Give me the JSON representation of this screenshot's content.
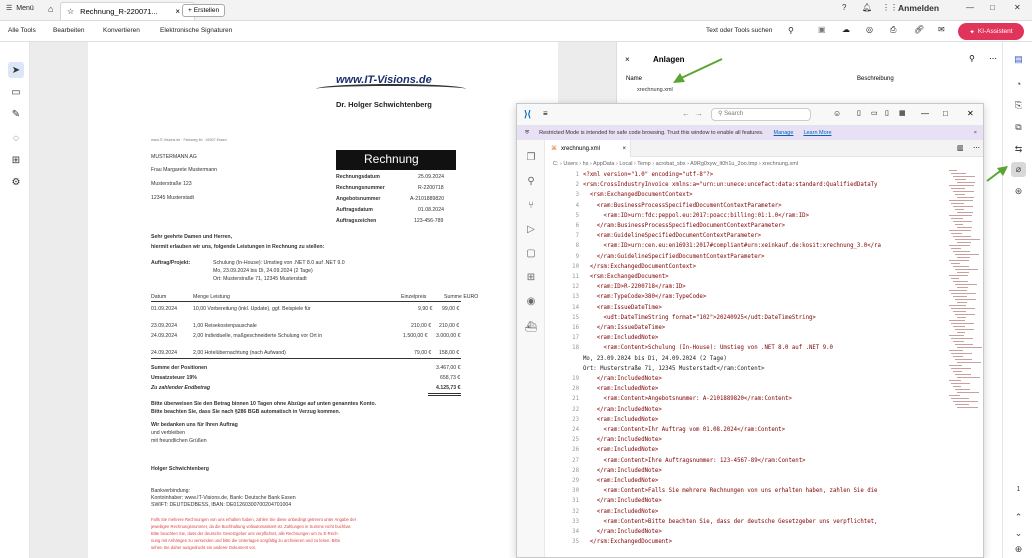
{
  "tabbar": {
    "menu_label": "Menü",
    "doc_tab_label": "Rechnung_R-220071...",
    "create_label": "Erstellen",
    "sign_in_label": "Anmelden"
  },
  "menubar": {
    "items": [
      "Alle Tools",
      "Bearbeiten",
      "Konvertieren",
      "Elektronische Signaturen"
    ],
    "search_label": "Text oder Tools suchen",
    "ai_label": "KI-Assistent"
  },
  "attachments": {
    "title": "Anlagen",
    "col_name": "Name",
    "col_desc": "Beschreibung",
    "file": "xrechnung.xml"
  },
  "invoice": {
    "logo": "www.IT-Visions.de",
    "owner": "Dr. Holger Schwichtenberg",
    "sender_line": "www.IT-Visions.de · Fahrweg 4b · 45307 Essen",
    "recipient": [
      "MUSTERMANN AG",
      "Frau Margarete Mustermann",
      "Musterstraße 123",
      "12345 Musterstadt"
    ],
    "title": "Rechnung",
    "meta": [
      {
        "label": "Rechnungsdatum",
        "value": "25.09.2024"
      },
      {
        "label": "Rechnungsnummer",
        "value": "R-2200718"
      },
      {
        "label": "Angebotsnummer",
        "value": "A-2101889820"
      },
      {
        "label": "Auftragsdatum",
        "value": "01.08.2024"
      },
      {
        "label": "Auftragszeichen",
        "value": "123-456-789"
      }
    ],
    "salutation": "Sehr geehrte Damen und Herren,",
    "intro": "hiermit erlauben wir uns, folgende Leistungen in Rechnung zu stellen:",
    "project_label": "Auftrag/Projekt:",
    "project_lines": [
      "Schulung (In-House): Umstieg von .NET 8.0 auf .NET 9.0",
      "Mo, 23.09.2024 bis Di, 24.09.2024 (2 Tage)",
      "Ort: Musterstraße 71, 12345 Musterstadt"
    ],
    "table_headers": [
      "Datum",
      "Menge Leistung",
      "Einzelpreis",
      "Summe EURO"
    ],
    "rows": [
      {
        "date": "01.09.2024",
        "desc": "10,00 Vorbereitung (inkl. Update), ggf. Beispiele für",
        "price": "9,90 €",
        "sum": "99,00 €"
      },
      {
        "date": "23.09.2024",
        "desc": "1,00 Reisekostenpauschale",
        "price": "210,00 €",
        "sum": "210,00 €"
      },
      {
        "date": "24.09.2024",
        "desc": "2,00 Individuelle, maßgeschneiderte Schulung vor Ort in",
        "price": "1.500,00 €",
        "sum": "3.000,00 €"
      },
      {
        "date": "24.09.2024",
        "desc": "2,00 Hotelübernachtung (nach Aufwand)",
        "price": "79,00 €",
        "sum": "158,00 €"
      }
    ],
    "sum_label": "Summe der Positionen",
    "sum_value": "3.467,00 €",
    "vat_label": "Umsatzsteuer 19%",
    "vat_value": "658,73 €",
    "total_label": "Zu zahlender Endbetrag",
    "total_value": "4.125,73 €",
    "payment_lines": [
      "Bitte überweisen Sie den Betrag binnen 10 Tagen ohne Abzüge auf unten genanntes Konto.",
      "Bitte beachten Sie, dass Sie nach §286 BGB automatisch in Verzug kommen."
    ],
    "thanks_lines": [
      "Wir bedanken uns für Ihren Auftrag",
      "und verbleiben",
      "mit freundlichen Grüßen"
    ],
    "signature": "Holger Schwichtenberg",
    "bank_lines": [
      "Bankverbindung:",
      "Kontoinhaber: www.IT-Visions.de, Bank: Deutsche Bank Essen",
      "SWIFT: DEUTDEDBESS, IBAN: DE01260300700204701004"
    ],
    "red_lines": [
      "Falls Sie mehrere Rechnungen von uns erhalten haben, zahlen Sie diese unbedingt getrennt unter Angabe der",
      "jeweiligen Rechnungsnummer, da die Buchhaltung vollautomatisiert ist. Zahlungen in Summe nicht buchbar.",
      "Bitte beachten Sie, dass der deutsche Gesetzgeber uns verpflichtet, alle Rechnungen um zu E-Rech-",
      "nung mit Anhängen zu versenden und bitte die Unterlagen sorgfältig zu archivieren und zu lesen. Bitte",
      "sehen Sie daher ausgedruckt ein anderer Dokument vor."
    ]
  },
  "vscode": {
    "search_placeholder": "Search",
    "banner_text": "Restricted Mode is intended for safe code browsing. Trust this window to enable all features.",
    "banner_manage": "Manage",
    "banner_learn": "Learn More",
    "tab_label": "xrechnung.xml",
    "breadcrumb": "C: › Users › hs › AppData › Local › Temp › acrobat_sbx › A9Rg0xyw_lt0h1u_2oo.tmp › xrechnung.xml",
    "lines": [
      {
        "n": "1",
        "t": "<?xml version=\"1.0\" encoding=\"utf-8\"?>"
      },
      {
        "n": "2",
        "t": "<rsm:CrossIndustryInvoice xmlns:a=\"urn:un:unece:uncefact:data:standard:QualifiedDataTy"
      },
      {
        "n": "3",
        "t": "  <rsm:ExchangedDocumentContext>"
      },
      {
        "n": "4",
        "t": "    <ram:BusinessProcessSpecifiedDocumentContextParameter>"
      },
      {
        "n": "5",
        "t": "      <ram:ID>urn:fdc:peppol.eu:2017:poacc:billing:01:1.0</ram:ID>"
      },
      {
        "n": "6",
        "t": "    </ram:BusinessProcessSpecifiedDocumentContextParameter>"
      },
      {
        "n": "7",
        "t": "    <ram:GuidelineSpecifiedDocumentContextParameter>"
      },
      {
        "n": "8",
        "t": "      <ram:ID>urn:cen.eu:en16931:2017#compliant#urn:xeinkauf.de:kosit:xrechnung_3.0</ra"
      },
      {
        "n": "9",
        "t": "    </ram:GuidelineSpecifiedDocumentContextParameter>"
      },
      {
        "n": "10",
        "t": "  </rsm:ExchangedDocumentContext>"
      },
      {
        "n": "11",
        "t": "  <rsm:ExchangedDocument>"
      },
      {
        "n": "12",
        "t": "    <ram:ID>R-2200718</ram:ID>"
      },
      {
        "n": "13",
        "t": "    <ram:TypeCode>380</ram:TypeCode>"
      },
      {
        "n": "14",
        "t": "    <ram:IssueDateTime>"
      },
      {
        "n": "15",
        "t": "      <udt:DateTimeString format=\"102\">20240925</udt:DateTimeString>"
      },
      {
        "n": "16",
        "t": "    </ram:IssueDateTime>"
      },
      {
        "n": "17",
        "t": "    <ram:IncludedNote>"
      },
      {
        "n": "18",
        "t": "      <ram:Content>Schulung (In-House): Umstieg von .NET 8.0 auf .NET 9.0"
      },
      {
        "n": "",
        "t": "Mo, 23.09.2024 bis Di, 24.09.2024 (2 Tage)"
      },
      {
        "n": "",
        "t": "Ort: Musterstraße 71, 12345 Musterstadt</ram:Content>"
      },
      {
        "n": "19",
        "t": "    </ram:IncludedNote>"
      },
      {
        "n": "20",
        "t": "    <ram:IncludedNote>"
      },
      {
        "n": "21",
        "t": "      <ram:Content>Angebotsnummer: A-2101889820</ram:Content>"
      },
      {
        "n": "22",
        "t": "    </ram:IncludedNote>"
      },
      {
        "n": "23",
        "t": "    <ram:IncludedNote>"
      },
      {
        "n": "24",
        "t": "      <ram:Content>Ihr Auftrag vom 01.08.2024</ram:Content>"
      },
      {
        "n": "25",
        "t": "    </ram:IncludedNote>"
      },
      {
        "n": "26",
        "t": "    <ram:IncludedNote>"
      },
      {
        "n": "27",
        "t": "      <ram:Content>Ihre Auftragsnummer: 123-4567-89</ram:Content>"
      },
      {
        "n": "28",
        "t": "    </ram:IncludedNote>"
      },
      {
        "n": "29",
        "t": "    <ram:IncludedNote>"
      },
      {
        "n": "30",
        "t": "      <ram:Content>Falls Sie mehrere Rechnungen von uns erhalten haben, zahlen Sie die"
      },
      {
        "n": "31",
        "t": "    </ram:IncludedNote>"
      },
      {
        "n": "32",
        "t": "    <ram:IncludedNote>"
      },
      {
        "n": "33",
        "t": "      <ram:Content>Bitte beachten Sie, dass der deutsche Gesetzgeber uns verpflichtet,"
      },
      {
        "n": "34",
        "t": "    </ram:IncludedNote>"
      },
      {
        "n": "35",
        "t": "  </rsm:ExchangedDocument>"
      }
    ]
  },
  "rightrail": {
    "page_number": "1"
  },
  "colors": {
    "ai_button": "#e0345a",
    "arrow": "#5aa532",
    "vscode_blue": "#0066b8",
    "xml_tag": "#800000"
  }
}
